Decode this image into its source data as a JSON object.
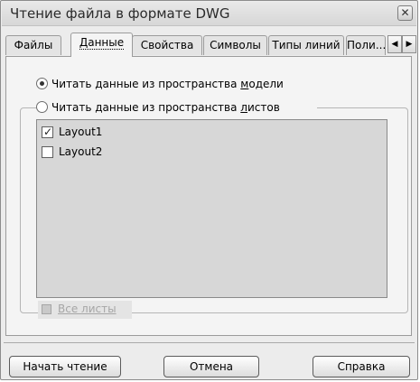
{
  "window": {
    "title": "Чтение файла в формате DWG",
    "close_glyph": "✕"
  },
  "tabs": [
    {
      "label": "Файлы"
    },
    {
      "label": "Данные",
      "active": true
    },
    {
      "label": "Свойства"
    },
    {
      "label": "Символы"
    },
    {
      "label": "Типы линий"
    },
    {
      "label": "Поли..."
    }
  ],
  "tab_scroll": {
    "left": "◀",
    "right": "▶"
  },
  "data_panel": {
    "radio_model": {
      "label_before": "Читать данные из пространства ",
      "label_underlined": "м",
      "label_after": "одели",
      "selected": true
    },
    "radio_layouts": {
      "label_before": "Читать данные из пространства ",
      "label_underlined": "л",
      "label_after": "истов",
      "selected": false
    },
    "layouts": [
      {
        "name": "Layout1",
        "checked": true
      },
      {
        "name": "Layout2",
        "checked": false
      }
    ],
    "check_glyph": "✓",
    "all_sheets": {
      "label": "Все листы",
      "enabled": false
    }
  },
  "buttons": {
    "start": "Начать чтение",
    "cancel": "Отмена",
    "help": "Справка"
  }
}
